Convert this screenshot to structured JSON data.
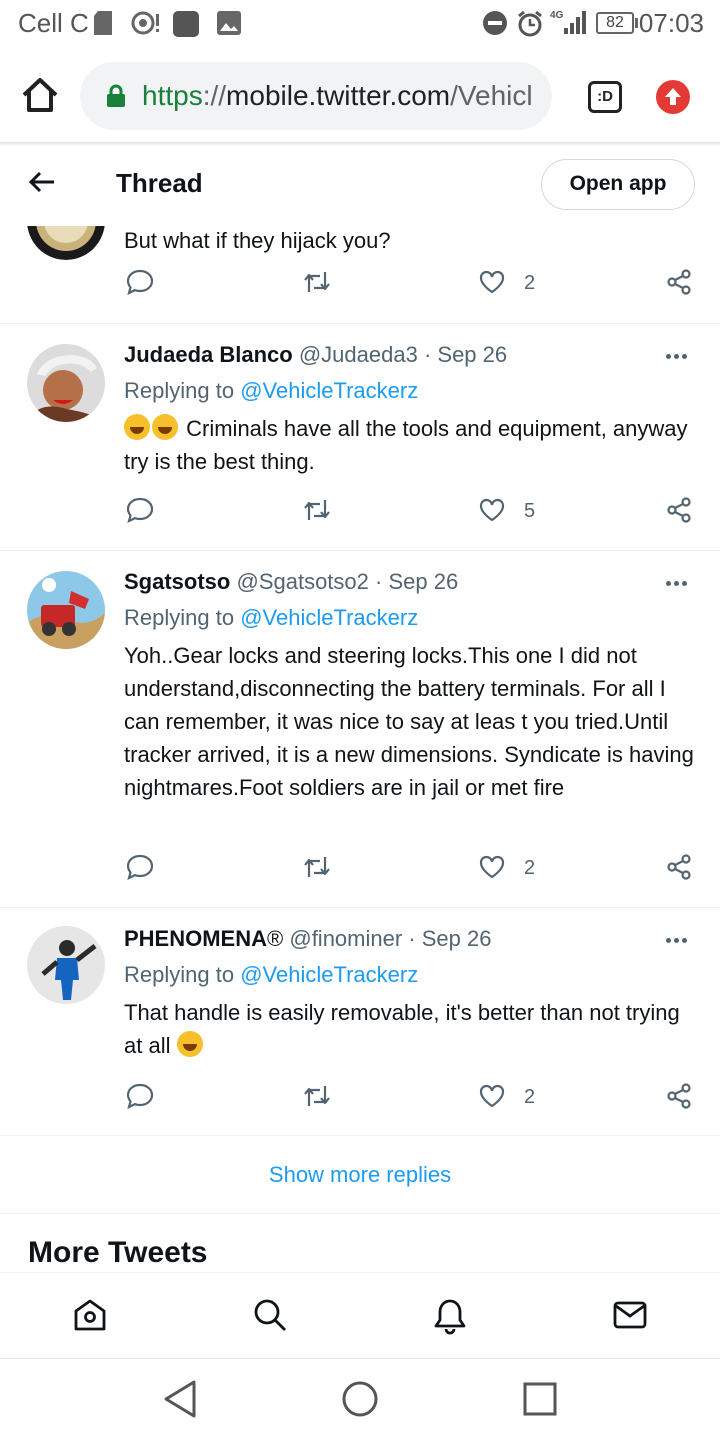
{
  "status_bar": {
    "carrier": "Cell C",
    "network": "4G",
    "battery": "82",
    "time": "07:03"
  },
  "browser": {
    "url_scheme": "https",
    "url_sep": "://",
    "url_host": "mobile.twitter.com",
    "url_path": "/Vehicl",
    "tabs_label": ":D"
  },
  "header": {
    "title": "Thread",
    "open_app": "Open app"
  },
  "partial_tweet": {
    "text": "But what if they hijack you?",
    "likes": "2"
  },
  "tweets": [
    {
      "name": "Judaeda Blanco",
      "handle": "@Judaeda3",
      "date": "Sep 26",
      "replying_label": "Replying to ",
      "replying_to": "@VehicleTrackerz",
      "text": "Criminals have all the tools and equipment, anyway try is the best thing.",
      "likes": "5"
    },
    {
      "name": "Sgatsotso",
      "handle": "@Sgatsotso2",
      "date": "Sep 26",
      "replying_label": "Replying to ",
      "replying_to": "@VehicleTrackerz",
      "text": "Yoh..Gear locks and steering locks.This one I did not understand,disconnecting the battery terminals. For all I can remember, it was nice to say at leas t you tried.Until tracker arrived, it is a new dimensions. Syndicate is having nightmares.Foot soldiers are in jail or met fire",
      "likes": "2"
    },
    {
      "name": "PHENOMENA",
      "name_mark": "®",
      "handle": "@finominer",
      "date": "Sep 26",
      "replying_label": "Replying to ",
      "replying_to": "@VehicleTrackerz",
      "text": "That handle is easily removable, it's better than not trying at all",
      "likes": "2"
    }
  ],
  "dot": " · ",
  "show_more": "Show more replies",
  "more_tweets": "More Tweets",
  "colors": {
    "accent": "#1d9bf0",
    "text_primary": "#0f1419",
    "text_secondary": "#536471",
    "secure": "#188038"
  },
  "icons": {
    "tabbar": [
      "home-icon",
      "search-icon",
      "notifications-icon",
      "messages-icon"
    ],
    "actions": [
      "reply-icon",
      "retweet-icon",
      "like-icon",
      "share-icon"
    ]
  }
}
